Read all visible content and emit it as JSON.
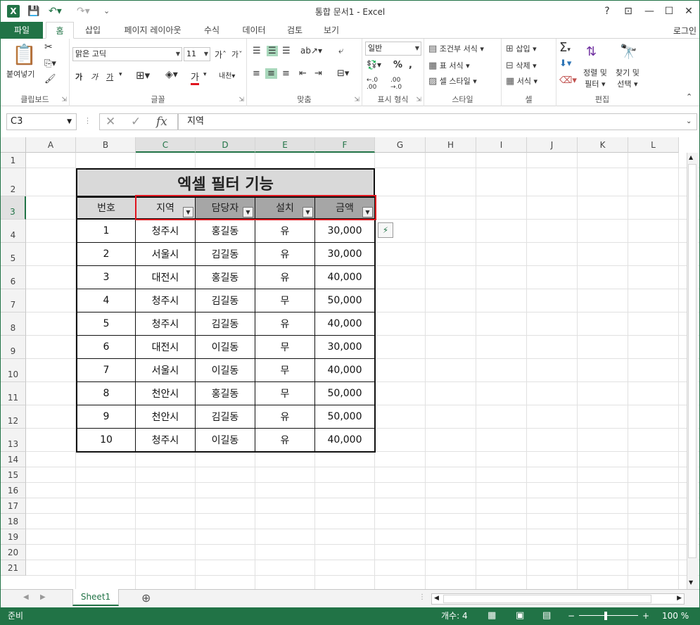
{
  "window": {
    "title": "통합 문서1 - Excel",
    "help": "?",
    "restore_ribbon": "⊡",
    "minimize": "—",
    "maximize": "☐",
    "close": "✕"
  },
  "tabs": [
    "파일",
    "홈",
    "삽입",
    "페이지 레이아웃",
    "수식",
    "데이터",
    "검토",
    "보기"
  ],
  "login": "로그인",
  "ribbon": {
    "clipboard": {
      "label": "클립보드",
      "paste": "붙여넣기"
    },
    "font": {
      "label": "글꼴",
      "font_name": "맑은 고딕",
      "font_size": "11",
      "bold": "가",
      "italic": "가",
      "underline": "가",
      "font_color": "가"
    },
    "align": {
      "label": "맞춤"
    },
    "number": {
      "label": "표시 형식",
      "format": "일반",
      "percent": "%"
    },
    "styles": {
      "label": "스타일",
      "conditional": "조건부 서식",
      "table": "표 서식",
      "cell": "셀 스타일"
    },
    "cells": {
      "label": "셀",
      "insert": "삽입",
      "delete": "삭제",
      "format": "서식"
    },
    "editing": {
      "label": "편집",
      "sort_filter_1": "정렬 및",
      "sort_filter_2": "필터",
      "find_1": "찾기 및",
      "find_2": "선택"
    }
  },
  "formula_bar": {
    "name_box": "C3",
    "fx": "fx",
    "value": "지역"
  },
  "columns": [
    "A",
    "B",
    "C",
    "D",
    "E",
    "F",
    "G",
    "H",
    "I",
    "J",
    "K",
    "L"
  ],
  "rows": [
    "1",
    "2",
    "3",
    "4",
    "5",
    "6",
    "7",
    "8",
    "9",
    "10",
    "11",
    "12",
    "13",
    "14",
    "15",
    "16",
    "17",
    "18",
    "19",
    "20",
    "21"
  ],
  "table": {
    "title": "엑셀 필터 기능",
    "headers": [
      "번호",
      "지역",
      "담당자",
      "설치",
      "금액"
    ],
    "data": [
      [
        "1",
        "청주시",
        "홍길동",
        "유",
        "30,000"
      ],
      [
        "2",
        "서울시",
        "김길동",
        "유",
        "30,000"
      ],
      [
        "3",
        "대전시",
        "홍길동",
        "유",
        "40,000"
      ],
      [
        "4",
        "청주시",
        "김길동",
        "무",
        "50,000"
      ],
      [
        "5",
        "청주시",
        "김길동",
        "유",
        "40,000"
      ],
      [
        "6",
        "대전시",
        "이길동",
        "무",
        "30,000"
      ],
      [
        "7",
        "서울시",
        "이길동",
        "무",
        "40,000"
      ],
      [
        "8",
        "천안시",
        "홍길동",
        "무",
        "50,000"
      ],
      [
        "9",
        "천안시",
        "김길동",
        "유",
        "50,000"
      ],
      [
        "10",
        "청주시",
        "이길동",
        "유",
        "40,000"
      ]
    ]
  },
  "sheet_tabs": [
    "Sheet1"
  ],
  "status": {
    "ready": "준비",
    "count": "개수: 4",
    "zoom": "100 %"
  },
  "colors": {
    "accent": "#217346",
    "highlight_border": "#e0141e",
    "header_gray": "#d9d9d9",
    "filter_header_dark": "#a6a6a6"
  }
}
